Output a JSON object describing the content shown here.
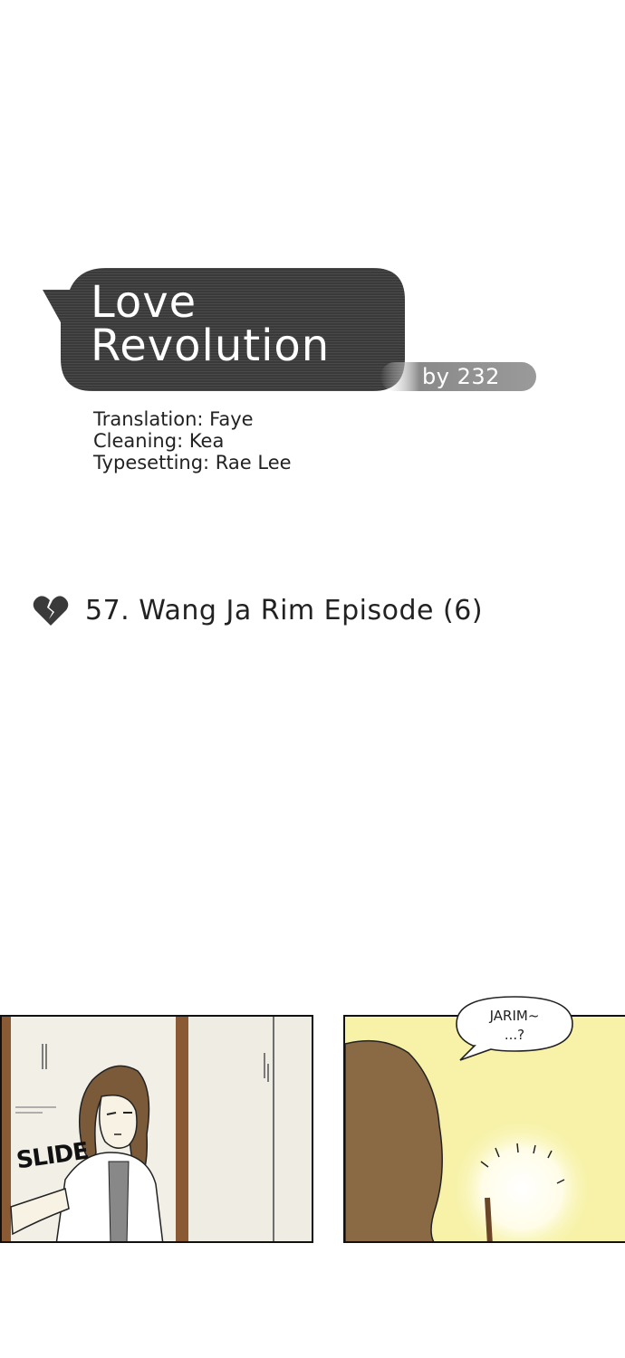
{
  "comic": {
    "title_line1": "Love",
    "title_line2": "Revolution",
    "byline": "by 232"
  },
  "credits": {
    "translation": "Translation: Faye",
    "cleaning": "Cleaning: Kea",
    "typesetting": "Typesetting: Rae Lee"
  },
  "episode": {
    "icon": "broken-heart-icon",
    "title": "57. Wang Ja Rim Episode (6)"
  },
  "panels": {
    "left": {
      "sfx": "SLIDE"
    },
    "right": {
      "speech_line1": "JARIM~",
      "speech_line2": "...?"
    }
  },
  "colors": {
    "title_bubble": "#3b3b3b",
    "byline_bar": "#8a8a8a",
    "panel_right_bg": "#f7f2a8",
    "panel_left_bg": "#ece8dd"
  }
}
